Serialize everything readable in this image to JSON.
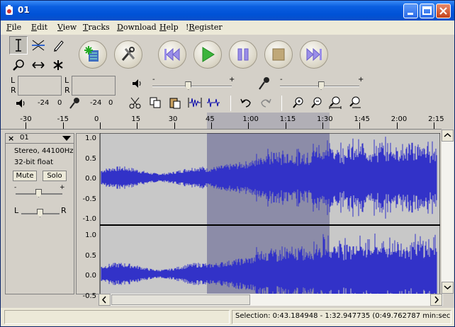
{
  "window": {
    "title": "01"
  },
  "menu": [
    {
      "label": "File",
      "key": "F",
      "rest": "ile"
    },
    {
      "label": "Edit",
      "key": "E",
      "rest": "dit"
    },
    {
      "label": "View",
      "key": "V",
      "rest": "iew"
    },
    {
      "label": "Tracks",
      "key": "T",
      "rest": "racks"
    },
    {
      "label": "Download",
      "key": "D",
      "rest": "ownload"
    },
    {
      "label": "Help",
      "key": "H",
      "rest": "elp"
    },
    {
      "label": "!Register",
      "key": "R",
      "pre": "!",
      "rest": "egister"
    }
  ],
  "meters": {
    "left_label": "L",
    "right_label": "R",
    "db1": "-24",
    "zero1": "0",
    "db2": "-24",
    "zero2": "0"
  },
  "mixer": {
    "minus1": "-",
    "plus1": "+",
    "minus2": "-",
    "plus2": "+",
    "output_volume": 0.45,
    "input_volume": 0.52
  },
  "ruler": {
    "ticks": [
      "-30",
      "-15",
      "0",
      "15",
      "30",
      "45",
      "1:00",
      "1:15",
      "1:30",
      "1:45",
      "2:00",
      "2:15"
    ]
  },
  "track": {
    "name": "01",
    "format": "Stereo, 44100Hz",
    "bits": "32-bit float",
    "mute_label": "Mute",
    "solo_label": "Solo",
    "gain_minus": "-",
    "gain_plus": "+",
    "pan_left": "L",
    "pan_right": "R",
    "scale_top": [
      "1.0",
      "0.5",
      "0.0",
      "-0.5",
      "-1.0"
    ],
    "scale_bottom": [
      "1.0",
      "0.5",
      "0.0",
      "-0.5"
    ]
  },
  "status": {
    "selection": "Selection: 0:43.184948 - 1:32.947735 (0:49.762787 min:sec)"
  },
  "colors": {
    "wave": "#3232c8",
    "selection": "#8c8ca8",
    "track_bg": "#c8c8c8",
    "titlebar": "#0054e3"
  }
}
